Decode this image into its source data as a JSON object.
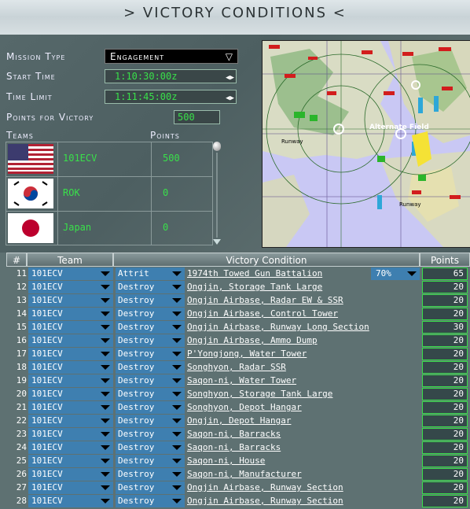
{
  "header": {
    "title": ">  VICTORY CONDITIONS  <"
  },
  "settings": {
    "mission_type_label": "Mission Type",
    "mission_type_value": "Engagement",
    "start_time_label": "Start Time",
    "start_time_value": "1:10:30:00z",
    "time_limit_label": "Time Limit",
    "time_limit_value": "1:11:45:00z",
    "points_label": "Points for Victory",
    "points_value": "500"
  },
  "teams": {
    "header_teams": "Teams",
    "header_points": "Points",
    "rows": [
      {
        "name": "101ECV",
        "points": "500",
        "flag": "us-flag-icon"
      },
      {
        "name": "ROK",
        "points": "0",
        "flag": "korea-flag-icon"
      },
      {
        "name": "Japan",
        "points": "0",
        "flag": "japan-flag-icon"
      }
    ]
  },
  "map": {
    "label_alternate_field": "Alternate Field",
    "label_runway_1": "Runway",
    "label_runway_2": "Runway"
  },
  "victory_table": {
    "columns": {
      "num": "#",
      "team": "Team",
      "condition": "Victory Condition",
      "points": "Points"
    },
    "rows": [
      {
        "num": "11",
        "team": "101ECV",
        "action": "Attrit",
        "target": "1974th Towed Gun Battalion",
        "pct": "70%",
        "points": "65"
      },
      {
        "num": "12",
        "team": "101ECV",
        "action": "Destroy",
        "target": "Ongjin, Storage Tank Large",
        "points": "20"
      },
      {
        "num": "13",
        "team": "101ECV",
        "action": "Destroy",
        "target": "Ongjin Airbase, Radar EW & SSR",
        "points": "20"
      },
      {
        "num": "14",
        "team": "101ECV",
        "action": "Destroy",
        "target": "Ongjin Airbase, Control Tower",
        "points": "20"
      },
      {
        "num": "15",
        "team": "101ECV",
        "action": "Destroy",
        "target": "Ongjin Airbase, Runway Long Section",
        "points": "30"
      },
      {
        "num": "16",
        "team": "101ECV",
        "action": "Destroy",
        "target": "Ongjin Airbase, Ammo Dump",
        "points": "20"
      },
      {
        "num": "17",
        "team": "101ECV",
        "action": "Destroy",
        "target": "P'Yongjong, Water Tower",
        "points": "20"
      },
      {
        "num": "18",
        "team": "101ECV",
        "action": "Destroy",
        "target": "Songhyon, Radar SSR",
        "points": "20"
      },
      {
        "num": "19",
        "team": "101ECV",
        "action": "Destroy",
        "target": "Saqon-ni, Water Tower",
        "points": "20"
      },
      {
        "num": "20",
        "team": "101ECV",
        "action": "Destroy",
        "target": "Songhyon, Storage Tank Large",
        "points": "20"
      },
      {
        "num": "21",
        "team": "101ECV",
        "action": "Destroy",
        "target": "Songhyon, Depot Hangar",
        "points": "20"
      },
      {
        "num": "22",
        "team": "101ECV",
        "action": "Destroy",
        "target": "Ongjin, Depot Hangar",
        "points": "20"
      },
      {
        "num": "23",
        "team": "101ECV",
        "action": "Destroy",
        "target": "Saqon-ni, Barracks",
        "points": "20"
      },
      {
        "num": "24",
        "team": "101ECV",
        "action": "Destroy",
        "target": "Saqon-ni, Barracks",
        "points": "20"
      },
      {
        "num": "25",
        "team": "101ECV",
        "action": "Destroy",
        "target": "Saqon-ni, House",
        "points": "20"
      },
      {
        "num": "26",
        "team": "101ECV",
        "action": "Destroy",
        "target": "Saqon-ni, Manufacturer",
        "points": "20"
      },
      {
        "num": "27",
        "team": "101ECV",
        "action": "Destroy",
        "target": "Ongjin Airbase, Runway Section",
        "points": "20"
      },
      {
        "num": "28",
        "team": "101ECV",
        "action": "Destroy",
        "target": "Ongjin Airbase, Runway Section",
        "points": "20"
      }
    ]
  },
  "colors": {
    "green_text": "#39e04a",
    "blue_cell": "#3e7fb0"
  }
}
